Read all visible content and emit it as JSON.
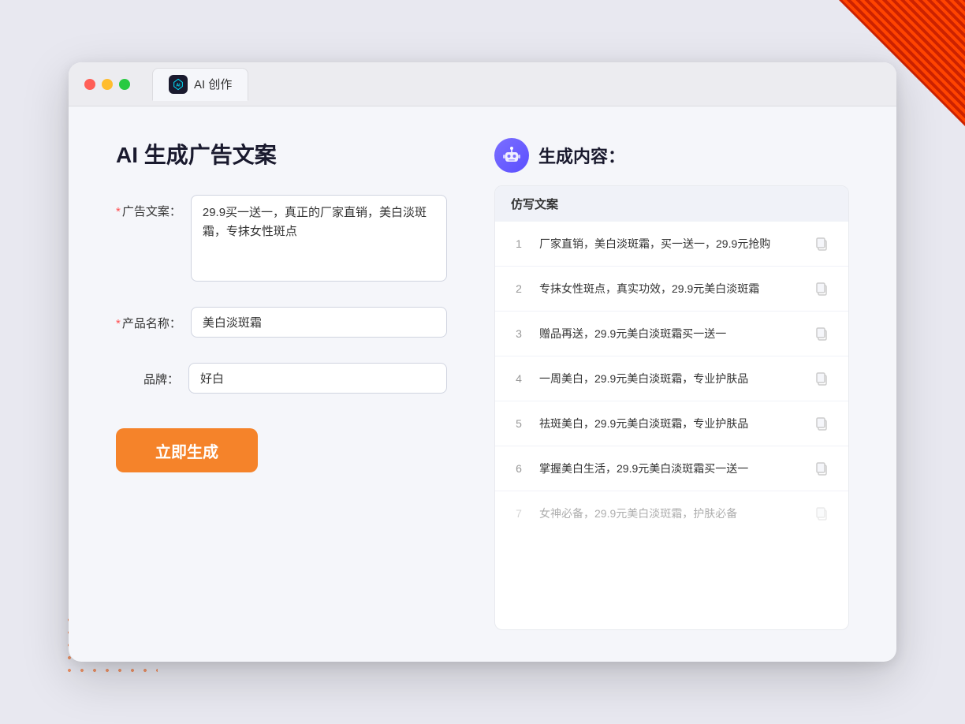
{
  "window": {
    "tab_title": "AI 创作"
  },
  "left_panel": {
    "title": "AI 生成广告文案",
    "fields": [
      {
        "label": "广告文案：",
        "required": true,
        "type": "textarea",
        "value": "29.9买一送一，真正的厂家直销，美白淡斑霜，专抹女性斑点",
        "placeholder": ""
      },
      {
        "label": "产品名称：",
        "required": true,
        "type": "input",
        "value": "美白淡斑霜",
        "placeholder": ""
      },
      {
        "label": "品牌：",
        "required": false,
        "type": "input",
        "value": "好白",
        "placeholder": ""
      }
    ],
    "generate_button": "立即生成"
  },
  "right_panel": {
    "title": "生成内容：",
    "table_header": "仿写文案",
    "rows": [
      {
        "number": 1,
        "text": "厂家直销，美白淡斑霜，买一送一，29.9元抢购",
        "faded": false
      },
      {
        "number": 2,
        "text": "专抹女性斑点，真实功效，29.9元美白淡斑霜",
        "faded": false
      },
      {
        "number": 3,
        "text": "赠品再送，29.9元美白淡斑霜买一送一",
        "faded": false
      },
      {
        "number": 4,
        "text": "一周美白，29.9元美白淡斑霜，专业护肤品",
        "faded": false
      },
      {
        "number": 5,
        "text": "祛斑美白，29.9元美白淡斑霜，专业护肤品",
        "faded": false
      },
      {
        "number": 6,
        "text": "掌握美白生活，29.9元美白淡斑霜买一送一",
        "faded": false
      },
      {
        "number": 7,
        "text": "女神必备，29.9元美白淡斑霜，护肤必备",
        "faded": true
      }
    ]
  }
}
